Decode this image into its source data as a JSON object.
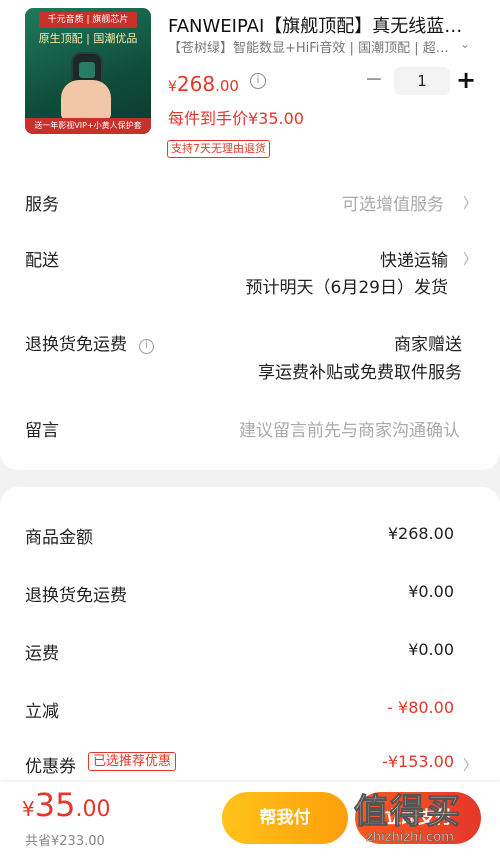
{
  "product": {
    "image": {
      "top_banner": "千元音质 | 旗舰芯片",
      "badge": "原生顶配 | 国潮优品",
      "bottom_banner": "送一年影视VIP+小黄人保护套"
    },
    "title": "FANWEIPAI【旗舰顶配】真无线蓝牙耳机",
    "spec": "【苍树绿】智能数显+HiFi音效 | 国潮顶配 | 超长续航",
    "price_symbol": "¥",
    "price_int": "268",
    "price_dec": ".00",
    "hand_price": "每件到手价¥35.00",
    "quantity": "1",
    "return_tag": "支持7天无理由退货"
  },
  "details": {
    "service": {
      "label": "服务",
      "value": "可选增值服务"
    },
    "delivery": {
      "label": "配送",
      "value": "快递运输",
      "eta": "预计明天（6月29日）发货"
    },
    "return_fee": {
      "label": "退换货免运费",
      "value": "商家赠送",
      "desc": "享运费补贴或免费取件服务"
    },
    "message": {
      "label": "留言",
      "placeholder": "建议留言前先与商家沟通确认"
    }
  },
  "summary": {
    "goods_amount": {
      "label": "商品金额",
      "value": "¥268.00"
    },
    "return_fee": {
      "label": "退换货免运费",
      "value": "¥0.00"
    },
    "shipping": {
      "label": "运费",
      "value": "¥0.00"
    },
    "discount": {
      "label": "立减",
      "value": "- ¥80.00"
    },
    "coupon": {
      "label": "优惠券",
      "tag": "已选推荐优惠",
      "value": "-¥153.00"
    }
  },
  "bottom": {
    "total_symbol": "¥",
    "total_int": "35",
    "total_dec": ".00",
    "saved": "共省¥233.00",
    "help_pay": "帮我付",
    "pay": "立即支付"
  },
  "watermark": {
    "big": "值得买",
    "small": "zhizhizhi.com"
  },
  "icons": {
    "info": "info-icon",
    "chevron": "chevron-right-icon",
    "expand": "chevron-down-icon"
  },
  "colors": {
    "accent_red": "#e4372a",
    "help_btn": "#ffb014",
    "pay_btn": "#ff4a24"
  }
}
